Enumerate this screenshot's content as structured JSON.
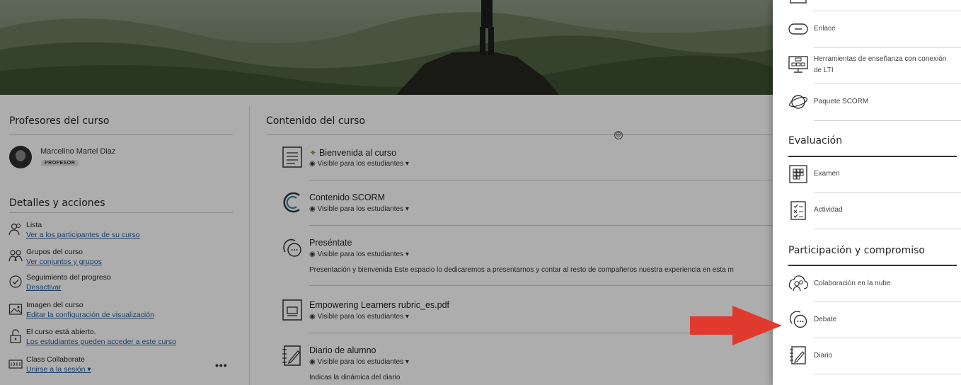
{
  "teachers": {
    "title": "Profesores del curso",
    "name": "Marcelino Martel Diaz",
    "role": "PROFESOR"
  },
  "details": {
    "title": "Detalles y acciones",
    "items": [
      {
        "title": "Lista",
        "link": "Ver a los participantes de su curso",
        "icon": "users-icon"
      },
      {
        "title": "Grupos del curso",
        "link": "Ver conjuntos y grupos",
        "icon": "groups-icon"
      },
      {
        "title": "Seguimiento del progreso",
        "link": "Desactivar",
        "icon": "check-circle-icon"
      },
      {
        "title": "Imagen del curso",
        "link": "Editar la configuración de visualización",
        "icon": "image-icon"
      },
      {
        "title": "El curso está abierto.",
        "link": "Los estudiantes pueden acceder a este curso",
        "icon": "unlock-icon"
      },
      {
        "title": "Class Collaborate",
        "link": "Unirse a la sesión",
        "icon": "collaborate-icon"
      }
    ],
    "more": "•••"
  },
  "content": {
    "title": "Contenido del curso",
    "add_icon": "⊕",
    "items": [
      {
        "title": "Bienvenida al curso",
        "visibility": "Visible para los estudiantes",
        "desc": ""
      },
      {
        "title": "Contenido SCORM",
        "visibility": "Visible para los estudiantes",
        "desc": ""
      },
      {
        "title": "Preséntate",
        "visibility": "Visible para los estudiantes",
        "desc": "Presentación y bienvenida Este espacio lo dedicaremos a presentarnos y contar al resto de compañeros nuestra experiencia en esta m"
      },
      {
        "title": "Empowering Learners rubric_es.pdf",
        "visibility": "Visible para los estudiantes",
        "desc": ""
      },
      {
        "title": "Diario de alumno",
        "visibility": "Visible para los estudiantes",
        "desc": "Indicas la dinámica del diario"
      }
    ]
  },
  "panel": {
    "items_top": [
      {
        "label": "Enlace",
        "icon": "link-icon"
      },
      {
        "label": "Herramientas de enseñanza con conexión",
        "label2": "de LTI",
        "icon": "lti-icon"
      },
      {
        "label": "Paquete SCORM",
        "icon": "scorm-icon"
      }
    ],
    "eval_title": "Evaluación",
    "eval_items": [
      {
        "label": "Examen",
        "icon": "exam-icon"
      },
      {
        "label": "Actividad",
        "icon": "assignment-icon"
      }
    ],
    "part_title": "Participación y compromiso",
    "part_items": [
      {
        "label": "Colaboración en la nube",
        "icon": "cloud-collab-icon"
      },
      {
        "label": "Debate",
        "icon": "discussion-icon"
      },
      {
        "label": "Diario",
        "icon": "journal-icon"
      }
    ]
  },
  "colors": {
    "arrow": "#e03a2f",
    "link": "#2a5d9a",
    "hero": "#4f6146"
  }
}
